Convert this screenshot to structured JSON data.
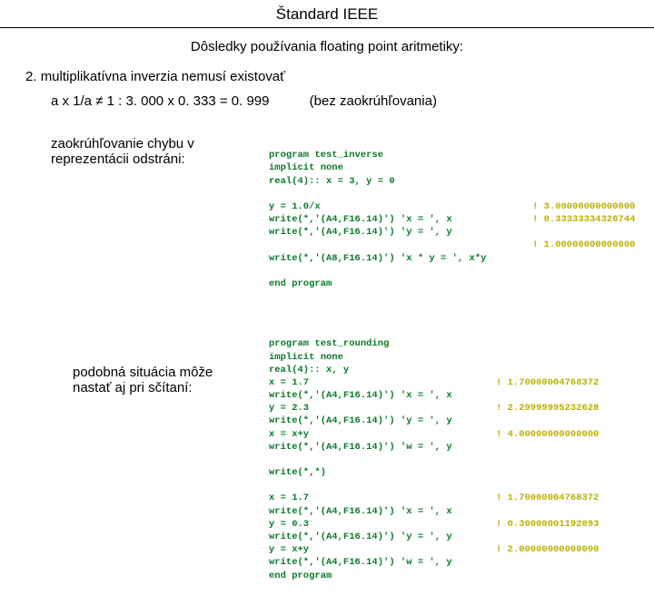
{
  "title": "Štandard IEEE",
  "subtitle": "Dôsledky používania floating point aritmetiky:",
  "item_number": "2.",
  "item_text": "multiplikatívna inverzia nemusí existovať",
  "formula": "a x 1/a ≠ 1   :   3. 000 x 0. 333 = 0. 999",
  "formula_note": "(bez zaokrúhľovania)",
  "label1_line1": "zaokrúhľovanie chybu v",
  "label1_line2": "reprezentácii odstráni:",
  "label2_line1": "podobná situácia môže",
  "label2_line2": "nastať aj pri sčítaní:",
  "code1": "program test_inverse\nimplicit none\nreal(4):: x = 3, y = 0\n\ny = 1.0/x\nwrite(*,'(A4,F16.14)') 'x = ', x\nwrite(*,'(A4,F16.14)') 'y = ', y\n\nwrite(*,'(A8,F16.14)') 'x * y = ', x*y\n\nend program",
  "code1_out": "\n\n\n\n\n! 3.00000000000000\n! 0.33333334326744\n\n! 1.00000000000000",
  "code2": "program test_rounding\nimplicit none\nreal(4):: x, y\nx = 1.7\nwrite(*,'(A4,F16.14)') 'x = ', x\ny = 2.3\nwrite(*,'(A4,F16.14)') 'y = ', y\nx = x+y\nwrite(*,'(A4,F16.14)') 'w = ', y\n\nwrite(*,*)\n\nx = 1.7\nwrite(*,'(A4,F16.14)') 'x = ', x\ny = 0.3\nwrite(*,'(A4,F16.14)') 'y = ', y\ny = x+y\nwrite(*,'(A4,F16.14)') 'w = ', y\nend program",
  "code2_out": "\n\n\n\n! 1.70000004768372\n\n! 2.29999995232628\n\n! 4.00000000000000\n\n\n\n\n! 1.70000004768372\n\n! 0.30000001192093\n\n! 2.00000000000000"
}
